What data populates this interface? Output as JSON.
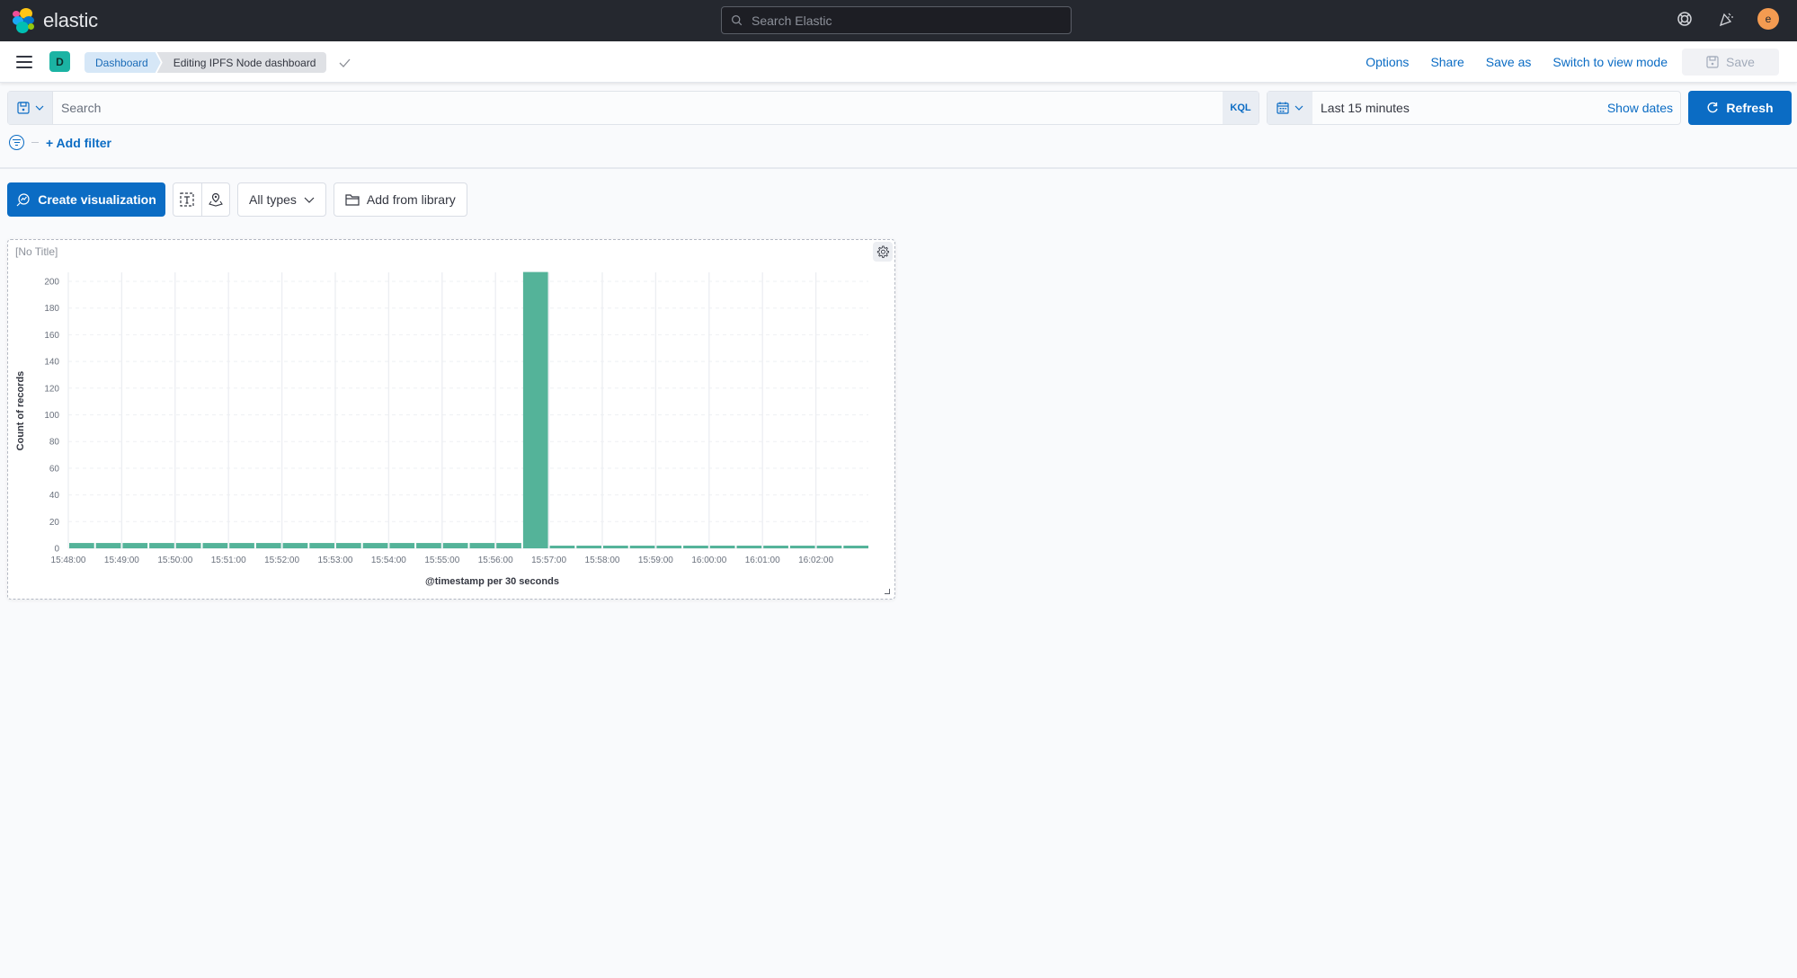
{
  "app": {
    "brand": "elastic",
    "global_search_placeholder": "Search Elastic",
    "user_initial": "e",
    "icons": [
      "help-icon",
      "newsfeed-icon",
      "user-avatar"
    ]
  },
  "subheader": {
    "space_initial": "D",
    "breadcrumbs": [
      {
        "label": "Dashboard"
      },
      {
        "label": "Editing IPFS Node dashboard"
      }
    ],
    "nav": {
      "options": "Options",
      "share": "Share",
      "save_as": "Save as",
      "switch_mode": "Switch to view mode",
      "save": "Save"
    }
  },
  "query": {
    "placeholder": "Search",
    "value": "",
    "language": "KQL",
    "time_range": "Last 15 minutes",
    "show_dates": "Show dates",
    "refresh": "Refresh",
    "add_filter": "+ Add filter"
  },
  "toolbar": {
    "create_visualization": "Create visualization",
    "all_types": "All types",
    "add_from_library": "Add from library",
    "colors": {
      "primary": "#0b6cc4"
    }
  },
  "panel": {
    "title": "[No Title]",
    "chart_data": {
      "type": "bar",
      "title": "",
      "xlabel": "@timestamp per 30 seconds",
      "ylabel": "Count of records",
      "ylim": [
        0,
        200
      ],
      "yticks": [
        0,
        20,
        40,
        60,
        80,
        100,
        120,
        140,
        160,
        180,
        200
      ],
      "xtick_labels": [
        "15:48:00",
        "15:49:00",
        "15:50:00",
        "15:51:00",
        "15:52:00",
        "15:53:00",
        "15:54:00",
        "15:55:00",
        "15:56:00",
        "15:57:00",
        "15:58:00",
        "15:59:00",
        "16:00:00",
        "16:01:00",
        "16:02:00"
      ],
      "categories": [
        "15:48:00",
        "15:48:30",
        "15:49:00",
        "15:49:30",
        "15:50:00",
        "15:50:30",
        "15:51:00",
        "15:51:30",
        "15:52:00",
        "15:52:30",
        "15:53:00",
        "15:53:30",
        "15:54:00",
        "15:54:30",
        "15:55:00",
        "15:55:30",
        "15:56:00",
        "15:56:30",
        "15:57:00",
        "15:57:30",
        "15:58:00",
        "15:58:30",
        "15:59:00",
        "15:59:30",
        "16:00:00",
        "16:00:30",
        "16:01:00",
        "16:01:30",
        "16:02:00",
        "16:02:30"
      ],
      "values": [
        4,
        4,
        4,
        4,
        4,
        4,
        4,
        4,
        4,
        4,
        4,
        4,
        4,
        4,
        4,
        4,
        4,
        207,
        2,
        2,
        2,
        2,
        2,
        2,
        2,
        2,
        2,
        2,
        2,
        2
      ],
      "grid": true,
      "legend": "none",
      "bar_color": "#54b399"
    }
  }
}
